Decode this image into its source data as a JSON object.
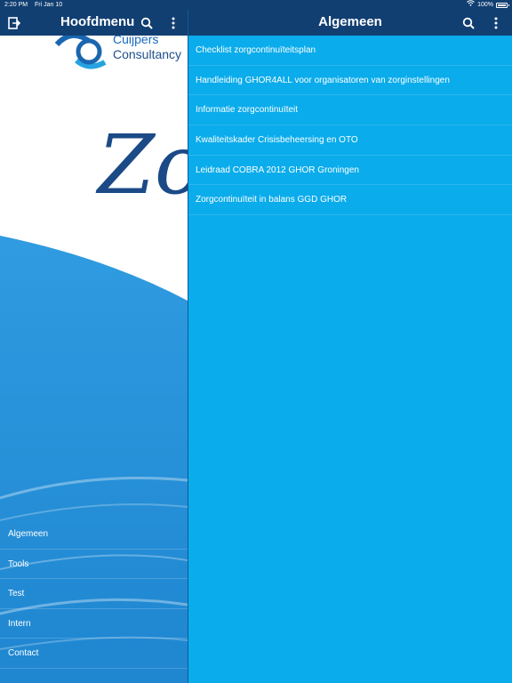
{
  "status": {
    "time": "2:20 PM",
    "date": "Fri Jan 10",
    "battery": "100%"
  },
  "left": {
    "title": "Hoofdmenu",
    "logo": {
      "line1": "Cuijpers",
      "line2": "Consultancy"
    },
    "hero_text": "Zo",
    "menu": [
      {
        "label": "Algemeen"
      },
      {
        "label": "Tools"
      },
      {
        "label": "Test"
      },
      {
        "label": "Intern"
      },
      {
        "label": "Contact"
      }
    ]
  },
  "right": {
    "title": "Algemeen",
    "items": [
      {
        "label": "Checklist zorgcontinuïteitsplan"
      },
      {
        "label": "Handleiding GHOR4ALL voor organisatoren van zorginstellingen"
      },
      {
        "label": "Informatie zorgcontinuïteit"
      },
      {
        "label": "Kwaliteitskader Crisisbeheersing en OTO"
      },
      {
        "label": "Leidraad COBRA 2012 GHOR Groningen"
      },
      {
        "label": "Zorgcontinuïteit in balans GGD GHOR"
      }
    ]
  },
  "icons": {
    "exit": "exit-icon",
    "search": "search-icon",
    "more": "more-vertical-icon",
    "wifi": "wifi-icon",
    "battery": "battery-icon"
  },
  "colors": {
    "toolbar": "#123f72",
    "content_bg": "#0aaceb",
    "text": "#ffffff"
  }
}
